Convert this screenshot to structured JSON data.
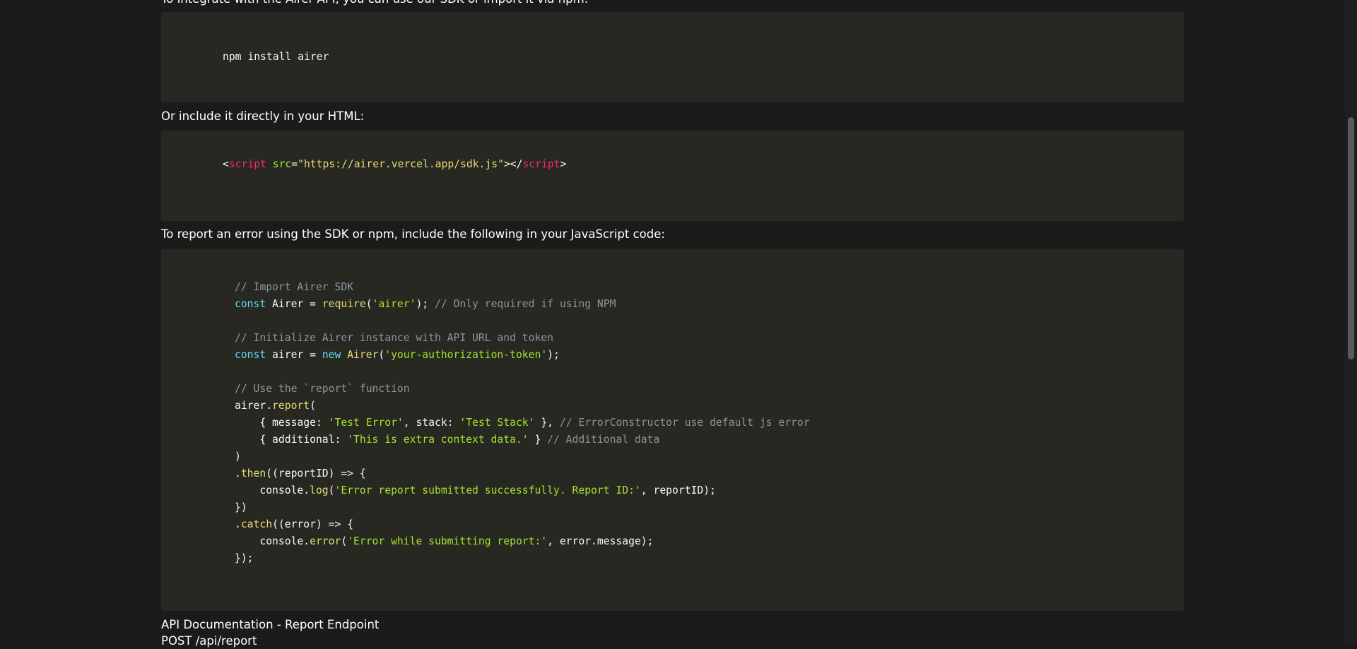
{
  "intro_partial": "To integrate with the Airer API, you can use our SDK or import it via npm:",
  "block1": {
    "lines": [
      [
        {
          "t": "npm install airer",
          "c": "pl"
        }
      ]
    ]
  },
  "html_heading": "Or include it directly in your HTML:",
  "block2": {
    "lines": [
      [
        {
          "t": "<",
          "c": "pl"
        },
        {
          "t": "script",
          "c": "tag"
        },
        {
          "t": " ",
          "c": "pl"
        },
        {
          "t": "src",
          "c": "attr"
        },
        {
          "t": "=",
          "c": "pl"
        },
        {
          "t": "\"https://airer.vercel.app/sdk.js\"",
          "c": "str"
        },
        {
          "t": "></",
          "c": "pl"
        },
        {
          "t": "script",
          "c": "tag"
        },
        {
          "t": ">",
          "c": "pl"
        }
      ]
    ]
  },
  "js_heading": "To report an error using the SDK or npm, include the following in your JavaScript code:",
  "block3": {
    "lines": [
      [
        {
          "t": "// Import Airer SDK",
          "c": "cm"
        }
      ],
      [
        {
          "t": "const",
          "c": "kw"
        },
        {
          "t": " Airer = ",
          "c": "pl"
        },
        {
          "t": "require",
          "c": "fn"
        },
        {
          "t": "(",
          "c": "pl"
        },
        {
          "t": "'airer'",
          "c": "s2"
        },
        {
          "t": "); ",
          "c": "pl"
        },
        {
          "t": "// Only required if using NPM",
          "c": "cm"
        }
      ],
      [],
      [
        {
          "t": "// Initialize Airer instance with API URL and token",
          "c": "cm"
        }
      ],
      [
        {
          "t": "const",
          "c": "kw"
        },
        {
          "t": " airer = ",
          "c": "pl"
        },
        {
          "t": "new",
          "c": "kw"
        },
        {
          "t": " ",
          "c": "pl"
        },
        {
          "t": "Airer",
          "c": "fn"
        },
        {
          "t": "(",
          "c": "pl"
        },
        {
          "t": "'your-authorization-token'",
          "c": "s2"
        },
        {
          "t": ");",
          "c": "pl"
        }
      ],
      [],
      [
        {
          "t": "// Use the `report` function",
          "c": "cm"
        }
      ],
      [
        {
          "t": "airer.",
          "c": "pl"
        },
        {
          "t": "report",
          "c": "fn"
        },
        {
          "t": "(",
          "c": "pl"
        }
      ],
      [
        {
          "t": "    { message: ",
          "c": "pl"
        },
        {
          "t": "'Test Error'",
          "c": "s2"
        },
        {
          "t": ", stack: ",
          "c": "pl"
        },
        {
          "t": "'Test Stack'",
          "c": "s2"
        },
        {
          "t": " }, ",
          "c": "pl"
        },
        {
          "t": "// ErrorConstructor use default js error",
          "c": "cm"
        }
      ],
      [
        {
          "t": "    { additional: ",
          "c": "pl"
        },
        {
          "t": "'This is extra context data.'",
          "c": "s2"
        },
        {
          "t": " } ",
          "c": "pl"
        },
        {
          "t": "// Additional data",
          "c": "cm"
        }
      ],
      [
        {
          "t": ")",
          "c": "pl"
        }
      ],
      [
        {
          "t": ".",
          "c": "pl"
        },
        {
          "t": "then",
          "c": "fn"
        },
        {
          "t": "((reportID) => {",
          "c": "pl"
        }
      ],
      [
        {
          "t": "    console.",
          "c": "pl"
        },
        {
          "t": "log",
          "c": "fn"
        },
        {
          "t": "(",
          "c": "pl"
        },
        {
          "t": "'Error report submitted successfully. Report ID:'",
          "c": "s2"
        },
        {
          "t": ", reportID);",
          "c": "pl"
        }
      ],
      [
        {
          "t": "})",
          "c": "pl"
        }
      ],
      [
        {
          "t": ".",
          "c": "pl"
        },
        {
          "t": "catch",
          "c": "fn"
        },
        {
          "t": "((error) => {",
          "c": "pl"
        }
      ],
      [
        {
          "t": "    console.",
          "c": "pl"
        },
        {
          "t": "error",
          "c": "fn"
        },
        {
          "t": "(",
          "c": "pl"
        },
        {
          "t": "'Error while submitting report:'",
          "c": "s2"
        },
        {
          "t": ", error.message);",
          "c": "pl"
        }
      ],
      [
        {
          "t": "});",
          "c": "pl"
        }
      ]
    ]
  },
  "api_heading": "API Documentation - Report Endpoint",
  "api_method_partial": "POST /api/report"
}
